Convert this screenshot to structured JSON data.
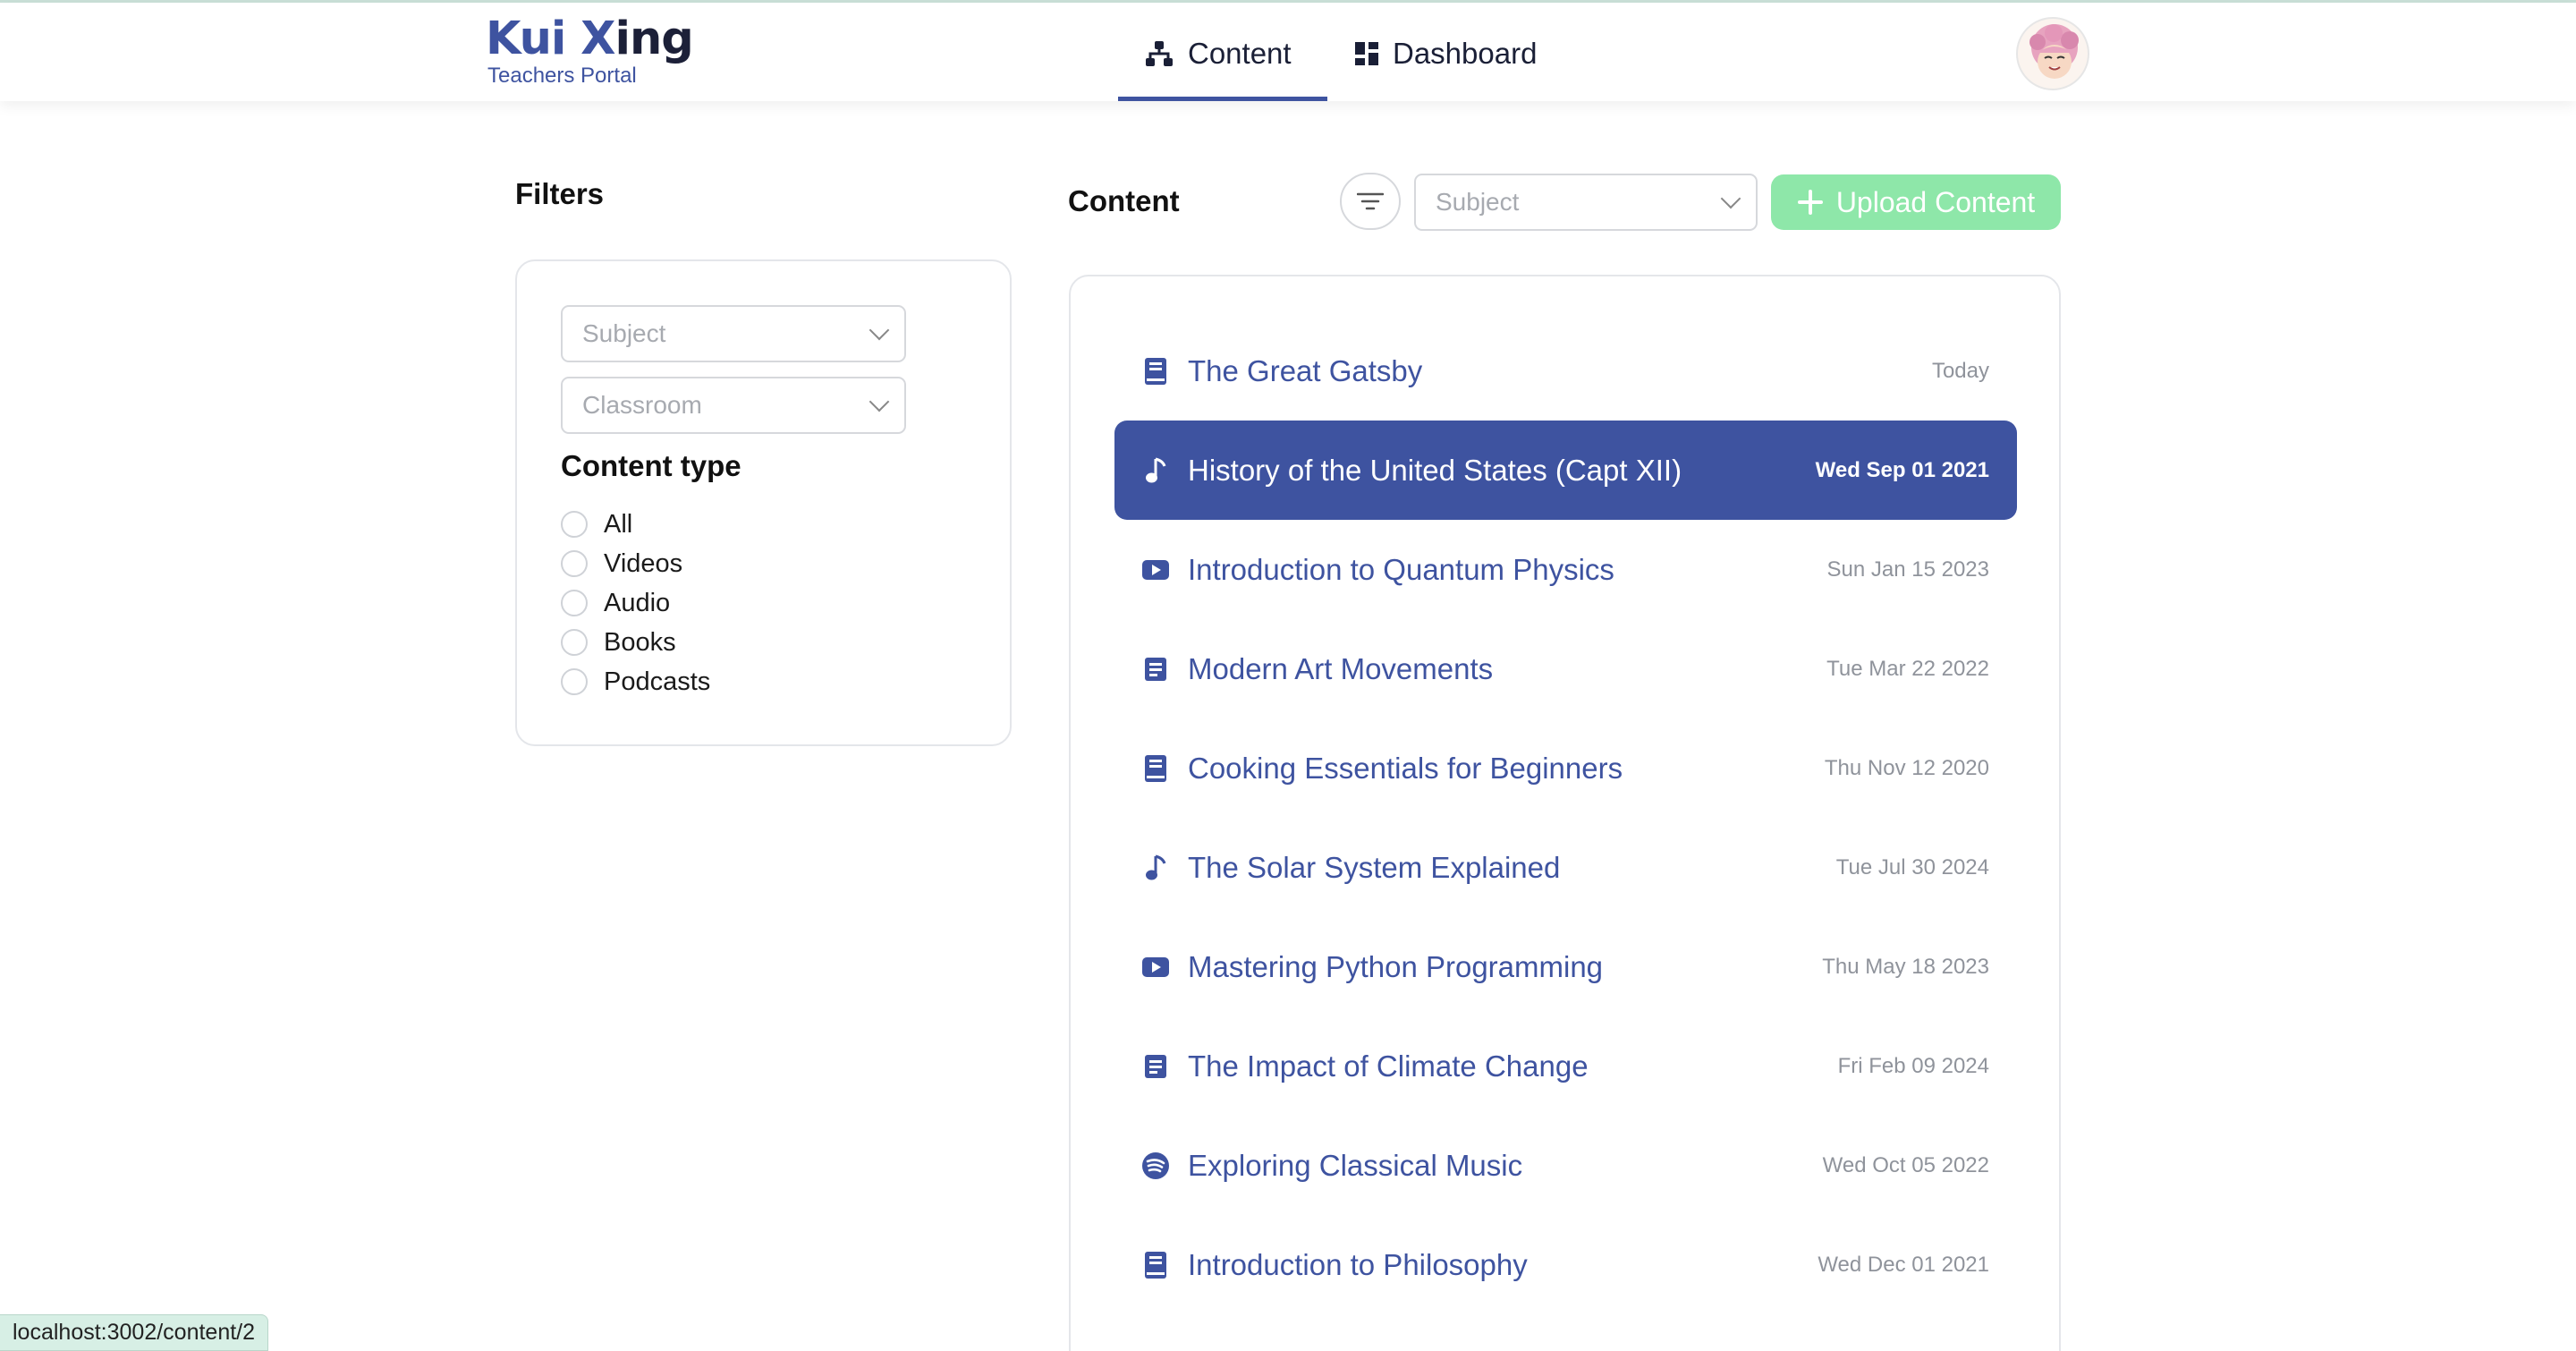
{
  "brand": {
    "title_part1": "Kui ",
    "title_part2": "X",
    "title_part3": "ing",
    "subtitle": "Teachers Portal"
  },
  "nav": [
    {
      "label": "Content",
      "icon": "sitemap-icon",
      "active": true
    },
    {
      "label": "Dashboard",
      "icon": "dashboard-grid-icon",
      "active": false
    }
  ],
  "filters": {
    "title": "Filters",
    "subject_placeholder": "Subject",
    "classroom_placeholder": "Classroom",
    "content_type_title": "Content type",
    "content_types": [
      "All",
      "Videos",
      "Audio",
      "Books",
      "Podcasts"
    ]
  },
  "content": {
    "title": "Content",
    "subject_placeholder": "Subject",
    "upload_label": "Upload Content",
    "items": [
      {
        "title": "The Great Gatsby",
        "date": "Today",
        "icon": "book-icon",
        "selected": false
      },
      {
        "title": "History of the United States (Capt XII)",
        "date": "Wed Sep 01 2021",
        "icon": "music-note-icon",
        "selected": true
      },
      {
        "title": "Introduction to Quantum Physics",
        "date": "Sun Jan 15 2023",
        "icon": "video-icon",
        "selected": false
      },
      {
        "title": "Modern Art Movements",
        "date": "Tue Mar 22 2022",
        "icon": "document-icon",
        "selected": false
      },
      {
        "title": "Cooking Essentials for Beginners",
        "date": "Thu Nov 12 2020",
        "icon": "book-icon",
        "selected": false
      },
      {
        "title": "The Solar System Explained",
        "date": "Tue Jul 30 2024",
        "icon": "music-note-icon",
        "selected": false
      },
      {
        "title": "Mastering Python Programming",
        "date": "Thu May 18 2023",
        "icon": "video-icon",
        "selected": false
      },
      {
        "title": "The Impact of Climate Change",
        "date": "Fri Feb 09 2024",
        "icon": "document-icon",
        "selected": false
      },
      {
        "title": "Exploring Classical Music",
        "date": "Wed Oct 05 2022",
        "icon": "podcast-icon",
        "selected": false
      },
      {
        "title": "Introduction to Philosophy",
        "date": "Wed Dec 01 2021",
        "icon": "book-icon",
        "selected": false
      }
    ]
  },
  "status_url": "localhost:3002/content/2",
  "colors": {
    "accent": "#3e53a0",
    "upload_button": "#8ee7a9",
    "selected_row": "#3e53a0"
  }
}
